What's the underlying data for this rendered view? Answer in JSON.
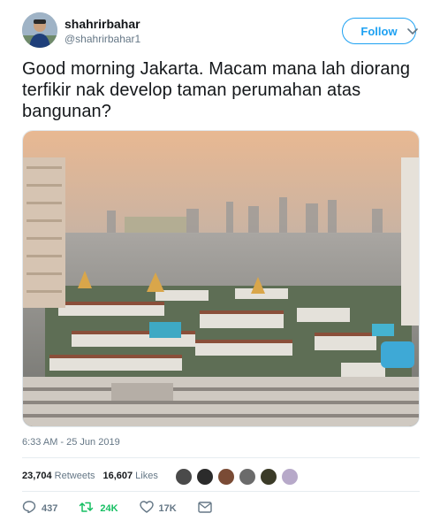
{
  "user": {
    "display_name": "shahrirbahar",
    "handle": "@shahrirbahar1",
    "follow_label": "Follow"
  },
  "tweet": {
    "text": "Good morning Jakarta. Macam mana lah diorang terfikir nak develop taman perumahan atas bangunan?",
    "timestamp": "6:33 AM - 25 Jun 2019"
  },
  "stats": {
    "retweets_count": "23,704",
    "retweets_label": "Retweets",
    "likes_count": "16,607",
    "likes_label": "Likes"
  },
  "actions": {
    "reply_count": "437",
    "retweet_count": "24K",
    "like_count": "17K"
  },
  "colors": {
    "accent": "#1da1f2",
    "retweet_green": "#17bf63",
    "muted": "#657786"
  },
  "icons": [
    "chevron-down-icon",
    "reply-icon",
    "retweet-icon",
    "heart-icon",
    "message-icon"
  ]
}
